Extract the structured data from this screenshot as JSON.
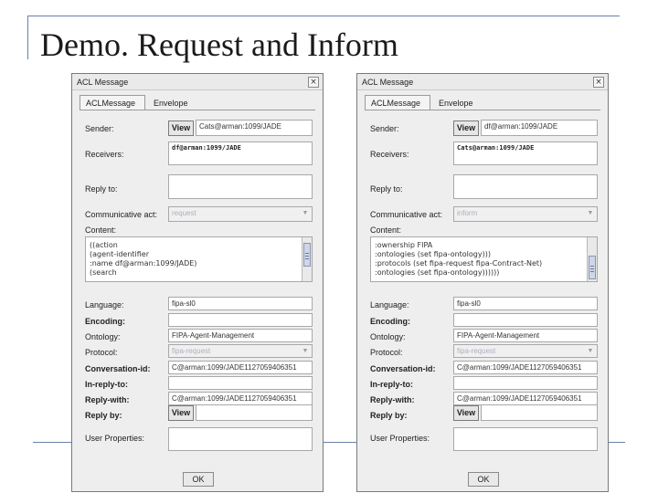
{
  "slide": {
    "title": "Demo. Request and Inform"
  },
  "labels": {
    "sender": "Sender:",
    "receivers": "Receivers:",
    "reply_to": "Reply to:",
    "communicative_act": "Communicative act:",
    "content": "Content:",
    "language": "Language:",
    "encoding": "Encoding:",
    "ontology": "Ontology:",
    "protocol": "Protocol:",
    "conversation_id": "Conversation-id:",
    "in_reply_to": "In-reply-to:",
    "reply_with": "Reply-with:",
    "reply_by": "Reply by:",
    "user_properties": "User Properties:",
    "view": "View",
    "ok": "OK",
    "close": "×"
  },
  "dialogs": [
    {
      "title": "ACL Message",
      "tabs": [
        "ACLMessage",
        "Envelope"
      ],
      "sender": "Cats@arman:1099/JADE",
      "receivers": "df@arman:1099/JADE",
      "reply_to": "",
      "communicative_act": "request",
      "content_lines": [
        "((action",
        "  (agent-identifier",
        "   :name df@arman:1099/JADE)",
        "  (search"
      ],
      "language": "fipa-sl0",
      "encoding": "",
      "ontology": "FIPA-Agent-Management",
      "protocol": "fipa-request",
      "conversation_id": "C@arman:1099/JADE1127059406351",
      "in_reply_to": "",
      "reply_with": "C@arman:1099/JADE1127059406351",
      "reply_by": "",
      "user_properties": ""
    },
    {
      "title": "ACL Message",
      "tabs": [
        "ACLMessage",
        "Envelope"
      ],
      "sender": "df@arman:1099/JADE",
      "receivers": "Cats@arman:1099/JADE",
      "reply_to": "",
      "communicative_act": "inform",
      "content_lines": [
        "   :ownership FIPA",
        "   :ontologies (set fipa-ontology)))",
        "  :protocols (set fipa-request fipa-Contract-Net)",
        "  :ontologies (set fipa-ontology))))))"
      ],
      "language": "fipa-sl0",
      "encoding": "",
      "ontology": "FIPA-Agent-Management",
      "protocol": "fipa-request",
      "conversation_id": "C@arman:1099/JADE1127059406351",
      "in_reply_to": "",
      "reply_with": "C@arman:1099/JADE1127059406351",
      "reply_by": "",
      "user_properties": ""
    }
  ],
  "icons": {
    "dropdown": "chevron-down-icon",
    "close": "close-icon"
  }
}
